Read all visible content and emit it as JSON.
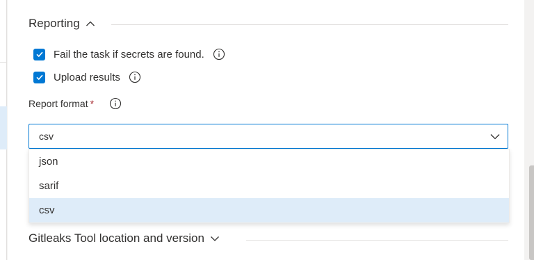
{
  "reporting": {
    "title": "Reporting",
    "fail_task_label": "Fail the task if secrets are found.",
    "fail_task_checked": true,
    "upload_results_label": "Upload results",
    "upload_results_checked": true,
    "report_format_label": "Report format",
    "required_marker": "*",
    "report_format_value": "csv",
    "report_format_options": [
      "json",
      "sarif",
      "csv"
    ],
    "report_format_selected": "csv"
  },
  "gitleaks_section": {
    "title": "Gitleaks Tool location and version"
  },
  "icons": {
    "reporting_chevron": "chevron-up-icon",
    "gitleaks_chevron": "chevron-down-icon",
    "info": "info-icon",
    "checkmark": "checkmark-icon",
    "dropdown_caret": "chevron-down-icon"
  },
  "colors": {
    "accent": "#0078d4",
    "selected_option_bg": "#deecf9",
    "required": "#a4262c"
  }
}
